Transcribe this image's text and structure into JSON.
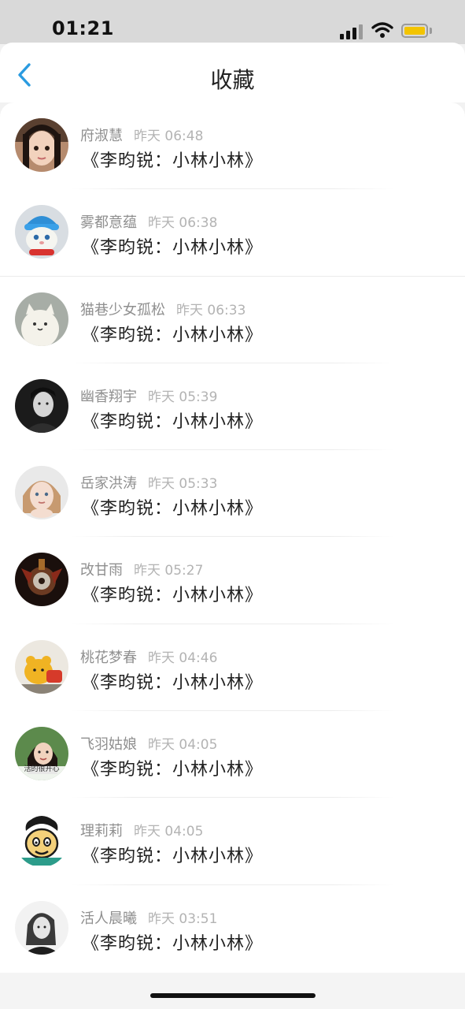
{
  "status_bar": {
    "time": "01:21"
  },
  "nav": {
    "title": "收藏",
    "back_icon": "chevron-left-icon"
  },
  "colors": {
    "accent": "#2a9be0",
    "battery": "#f3c400"
  },
  "items": [
    {
      "name": "府淑慧",
      "time": "昨天 06:48",
      "title": "《李昀锐：小林小林》",
      "avatar": "girl-portrait"
    },
    {
      "name": "雾都意蕴",
      "time": "昨天 06:38",
      "title": "《李昀锐：小林小林》",
      "avatar": "cat-in-hat"
    },
    {
      "name": "猫巷少女孤松",
      "time": "昨天 06:33",
      "title": "《李昀锐：小林小林》",
      "avatar": "cartoon-cat"
    },
    {
      "name": "幽香翔宇",
      "time": "昨天 05:39",
      "title": "《李昀锐：小林小林》",
      "avatar": "man-portrait"
    },
    {
      "name": "岳家洪涛",
      "time": "昨天 05:33",
      "title": "《李昀锐：小林小林》",
      "avatar": "child-portrait"
    },
    {
      "name": "改甘雨",
      "time": "昨天 05:27",
      "title": "《李昀锐：小林小林》",
      "avatar": "dark-emblem"
    },
    {
      "name": "桃花梦春",
      "time": "昨天 04:46",
      "title": "《李昀锐：小林小林》",
      "avatar": "yellow-bear"
    },
    {
      "name": "飞羽姑娘",
      "time": "昨天 04:05",
      "title": "《李昀锐：小林小林》",
      "avatar": "woman-portrait",
      "avatar_caption": "活的很开心"
    },
    {
      "name": "理莉莉",
      "time": "昨天 04:05",
      "title": "《李昀锐：小林小林》",
      "avatar": "cartoon-monkey"
    },
    {
      "name": "活人晨曦",
      "time": "昨天 03:51",
      "title": "《李昀锐：小林小林》",
      "avatar": "sketch-woman"
    }
  ]
}
